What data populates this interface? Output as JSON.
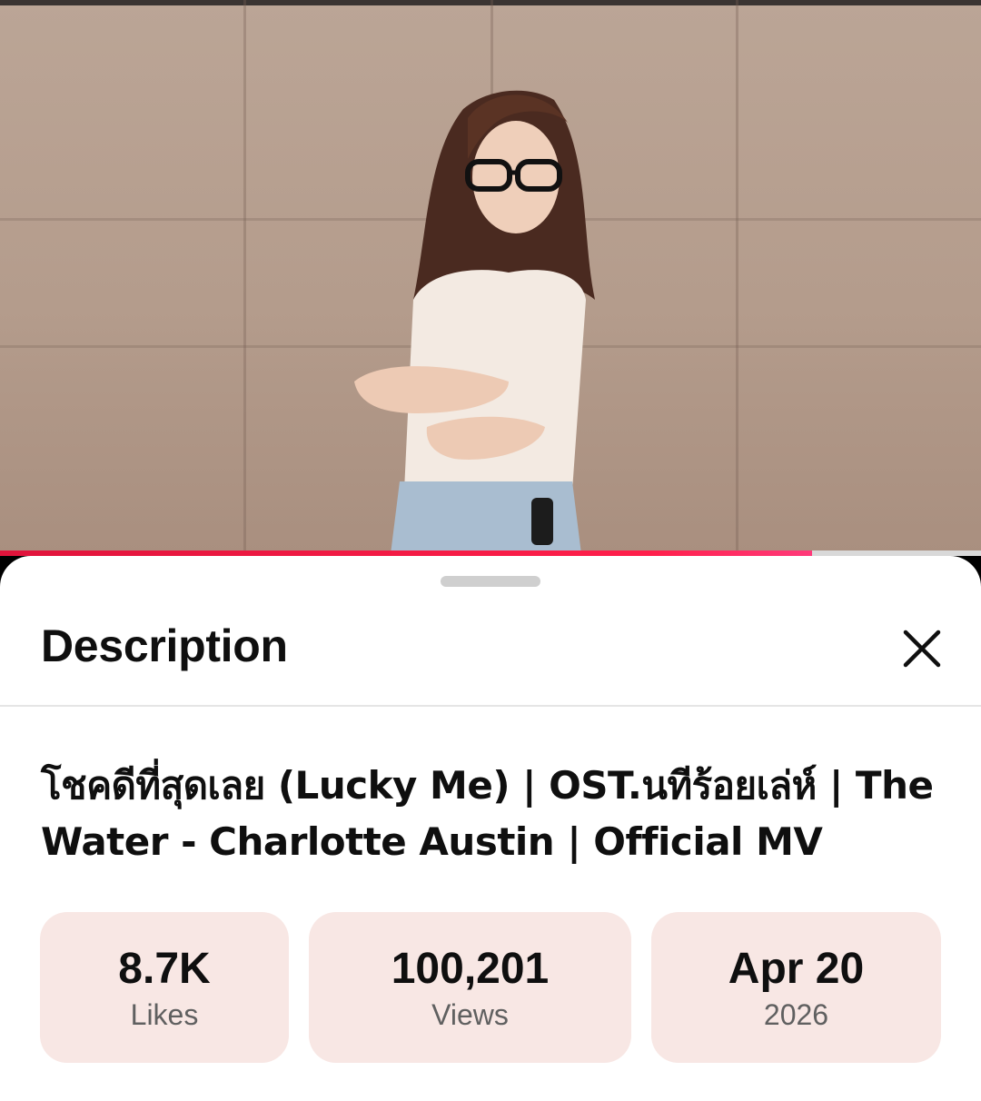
{
  "player": {
    "progress_fraction": 0.828,
    "progress_color": "#ff1f4b"
  },
  "sheet": {
    "title": "Description",
    "close_icon": "close-icon"
  },
  "video": {
    "title": "โชคดีที่สุดเลย (Lucky Me) | OST.นทีร้อยเล่ห์ | The Water - Charlotte Austin | Official MV"
  },
  "stats": {
    "likes_value": "8.7K",
    "likes_label": "Likes",
    "views_value": "100,201",
    "views_label": "Views",
    "date_value": "Apr 20",
    "date_year": "2026"
  },
  "colors": {
    "stat_background": "#f8e7e4",
    "accent": "#ff1f4b"
  }
}
